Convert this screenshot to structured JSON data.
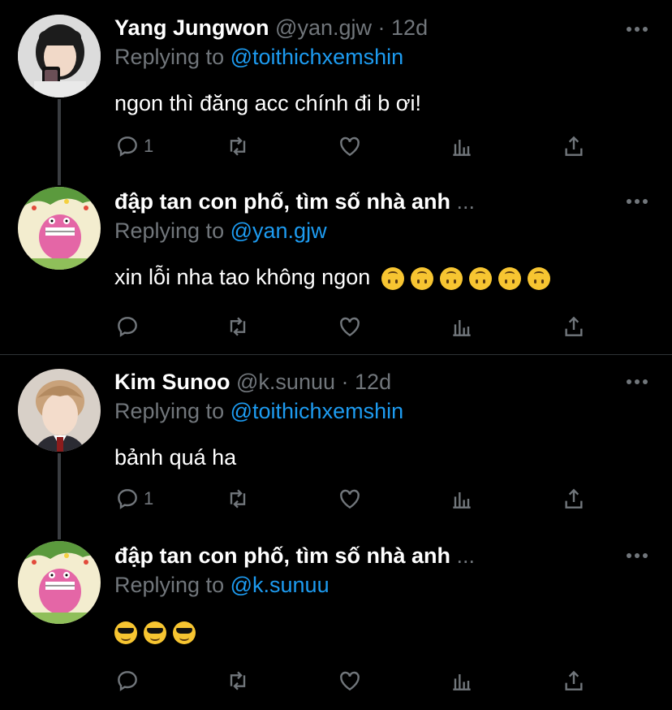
{
  "theme": {
    "background": "#000000",
    "accent": "#1d9bf0",
    "muted": "#71767b",
    "thread_line": "#3a3d41"
  },
  "tweets": [
    {
      "name": "Yang Jungwon",
      "handle": "@yan.gjw",
      "dot": "·",
      "time": "12d",
      "replying_prefix": "Replying to",
      "replying_to": "@toithichxemshin",
      "text": "ngon thì đăng acc chính đi b ơi!",
      "avatar": "girl-photo-avatar",
      "reply_count": "1",
      "retweet_count": "",
      "like_count": ""
    },
    {
      "name": "đập tan con phố, tìm số nhà anh",
      "ellipsis": "...",
      "replying_prefix": "Replying to",
      "replying_to": "@yan.gjw",
      "text": "xin lỗi nha tao không ngon",
      "emoji": [
        "upside-down-face",
        "upside-down-face",
        "upside-down-face",
        "upside-down-face",
        "upside-down-face",
        "upside-down-face"
      ],
      "avatar": "pink-dinosaur-avatar",
      "reply_count": "",
      "retweet_count": "",
      "like_count": ""
    },
    {
      "name": "Kim Sunoo",
      "handle": "@k.sunuu",
      "dot": "·",
      "time": "12d",
      "replying_prefix": "Replying to",
      "replying_to": "@toithichxemshin",
      "text": "bảnh quá ha",
      "avatar": "boy-photo-avatar",
      "reply_count": "1",
      "retweet_count": "",
      "like_count": ""
    },
    {
      "name": "đập tan con phố, tìm số nhà anh",
      "ellipsis": "...",
      "replying_prefix": "Replying to",
      "replying_to": "@k.sunuu",
      "text": "",
      "emoji": [
        "sunglasses-face",
        "sunglasses-face",
        "sunglasses-face"
      ],
      "avatar": "pink-dinosaur-avatar",
      "reply_count": "",
      "retweet_count": "",
      "like_count": ""
    }
  ]
}
